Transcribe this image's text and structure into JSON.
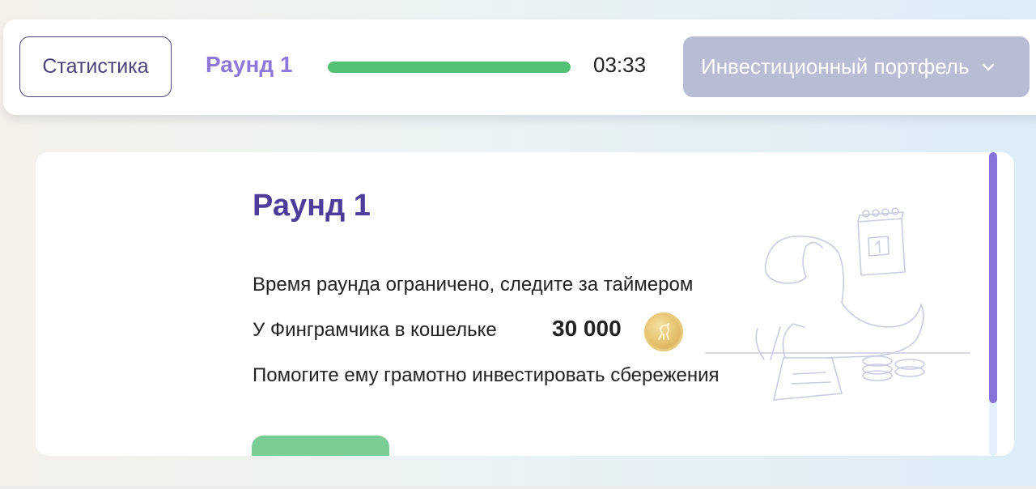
{
  "header": {
    "stats_label": "Статистика",
    "round_label": "Раунд 1",
    "progress_fraction": 1.0,
    "timer": "03:33",
    "portfolio_label": "Инвестиционный портфель",
    "portfolio_icon": "chevron-down-icon"
  },
  "card": {
    "title": "Раунд 1",
    "line1": "Время раунда ограничено, следите за таймером",
    "line2": "У Финграмчика в кошельке",
    "amount": "30 000",
    "coin_icon": "coin-icon",
    "line3": "Помогите ему грамотно инвестировать сбережения",
    "calendar_day": "1"
  },
  "colors": {
    "accent_purple": "#8f78dc",
    "title_purple": "#4e3c9a",
    "progress_green": "#52c075",
    "button_green": "#7acd93",
    "portfolio_bg": "#b9bdd3"
  }
}
